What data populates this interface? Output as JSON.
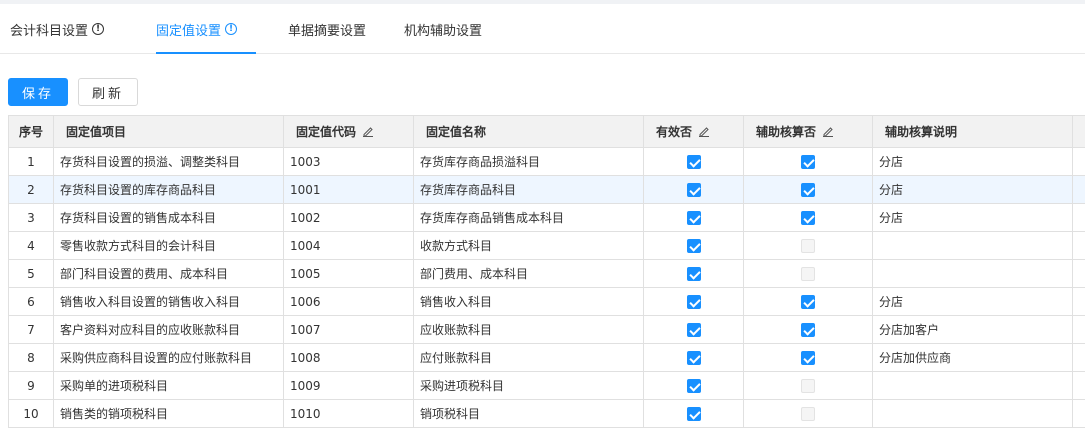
{
  "tabs": [
    {
      "label": "会计科目设置",
      "info": "!"
    },
    {
      "label": "固定值设置",
      "info": "!"
    },
    {
      "label": "单据摘要设置"
    },
    {
      "label": "机构辅助设置"
    }
  ],
  "toolbar": {
    "save_label": "保存",
    "refresh_label": "刷新"
  },
  "accent_color": "#1890ff",
  "table": {
    "headers": [
      "序号",
      "固定值项目",
      "固定值代码",
      "固定值名称",
      "有效否",
      "辅助核算否",
      "辅助核算说明"
    ],
    "rows": [
      {
        "no": "1",
        "item": "存货科目设置的损溢、调整类科目",
        "code": "1003",
        "name": "存货库存商品损溢科目",
        "valid": true,
        "aux": true,
        "note": "分店"
      },
      {
        "no": "2",
        "item": "存货科目设置的库存商品科目",
        "code": "1001",
        "name": "存货库存商品科目",
        "valid": true,
        "aux": true,
        "note": "分店"
      },
      {
        "no": "3",
        "item": "存货科目设置的销售成本科目",
        "code": "1002",
        "name": "存货库存商品销售成本科目",
        "valid": true,
        "aux": true,
        "note": "分店"
      },
      {
        "no": "4",
        "item": "零售收款方式科目的会计科目",
        "code": "1004",
        "name": "收款方式科目",
        "valid": true,
        "aux": false,
        "note": ""
      },
      {
        "no": "5",
        "item": "部门科目设置的费用、成本科目",
        "code": "1005",
        "name": "部门费用、成本科目",
        "valid": true,
        "aux": false,
        "note": ""
      },
      {
        "no": "6",
        "item": "销售收入科目设置的销售收入科目",
        "code": "1006",
        "name": "销售收入科目",
        "valid": true,
        "aux": true,
        "note": "分店"
      },
      {
        "no": "7",
        "item": "客户资料对应科目的应收账款科目",
        "code": "1007",
        "name": "应收账款科目",
        "valid": true,
        "aux": true,
        "note": "分店加客户"
      },
      {
        "no": "8",
        "item": "采购供应商科目设置的应付账款科目",
        "code": "1008",
        "name": "应付账款科目",
        "valid": true,
        "aux": true,
        "note": "分店加供应商"
      },
      {
        "no": "9",
        "item": "采购单的进项税科目",
        "code": "1009",
        "name": "采购进项税科目",
        "valid": true,
        "aux": false,
        "note": ""
      },
      {
        "no": "10",
        "item": "销售类的销项税科目",
        "code": "1010",
        "name": "销项税科目",
        "valid": true,
        "aux": false,
        "note": ""
      }
    ]
  }
}
